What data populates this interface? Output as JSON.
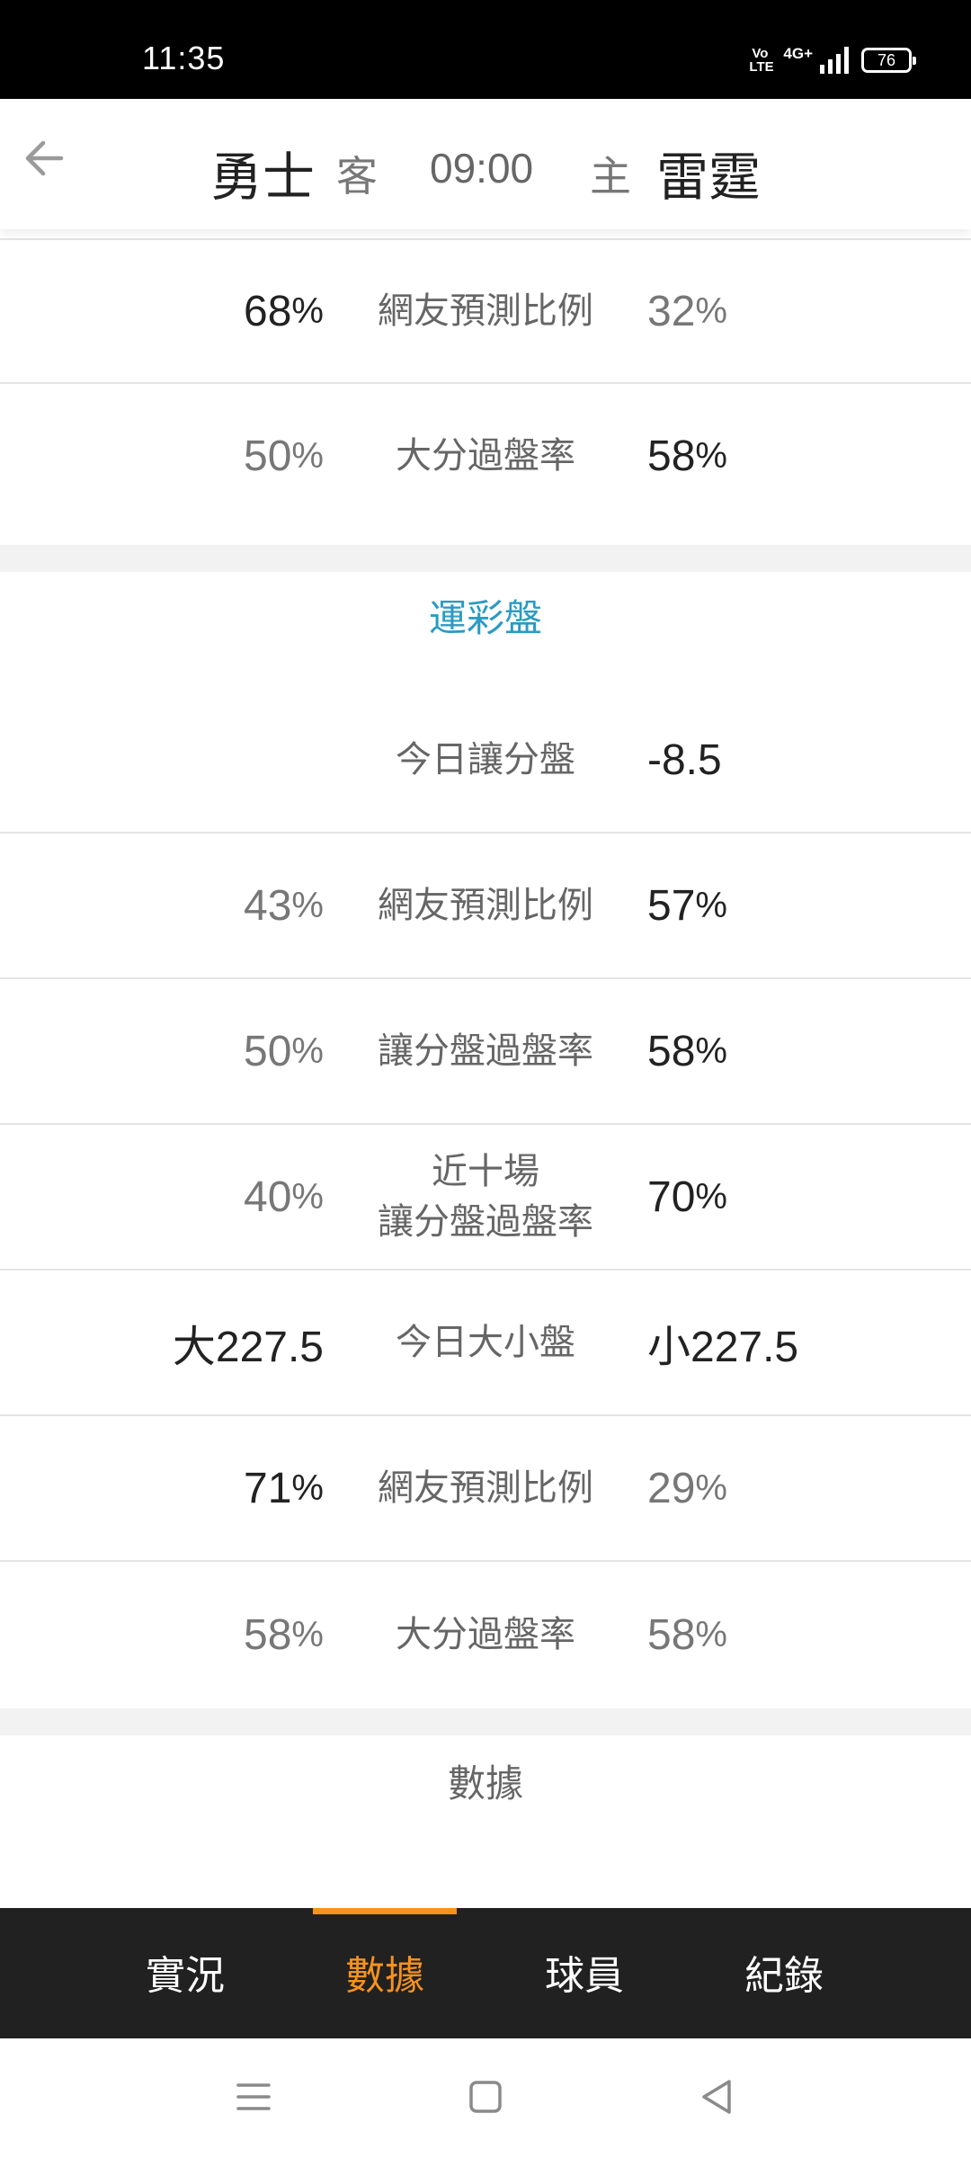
{
  "status_bar": {
    "time": "11:35",
    "volte": "Vo LTE",
    "network": "4G+",
    "battery": "76"
  },
  "header": {
    "away_team": "勇士",
    "away_tag": "客",
    "game_time": "09:00",
    "home_tag": "主",
    "home_team": "雷霆"
  },
  "stats_top": [
    {
      "left_value": "68",
      "left_unit": "%",
      "label": "網友預測比例",
      "right_value": "32",
      "right_unit": "%"
    },
    {
      "left_value": "50",
      "left_unit": "%",
      "label": "大分過盤率",
      "right_value": "58",
      "right_unit": "%"
    }
  ],
  "section_title": "運彩盤",
  "stats_lottery": [
    {
      "left_value": "",
      "left_unit": "",
      "label": "今日讓分盤",
      "right_value": "-8.5",
      "right_unit": ""
    },
    {
      "left_value": "43",
      "left_unit": "%",
      "label": "網友預測比例",
      "right_value": "57",
      "right_unit": "%"
    },
    {
      "left_value": "50",
      "left_unit": "%",
      "label": "讓分盤過盤率",
      "right_value": "58",
      "right_unit": "%"
    },
    {
      "left_value": "40",
      "left_unit": "%",
      "label_line1": "近十場",
      "label_line2": "讓分盤過盤率",
      "right_value": "70",
      "right_unit": "%"
    },
    {
      "left_value": "大227.5",
      "left_unit": "",
      "label": "今日大小盤",
      "right_value": "小227.5",
      "right_unit": ""
    },
    {
      "left_value": "71",
      "left_unit": "%",
      "label": "網友預測比例",
      "right_value": "29",
      "right_unit": "%"
    },
    {
      "left_value": "58",
      "left_unit": "%",
      "label": "大分過盤率",
      "right_value": "58",
      "right_unit": "%"
    }
  ],
  "footer_label": "數據",
  "tabs": [
    {
      "label": "實況",
      "active": false
    },
    {
      "label": "數據",
      "active": true
    },
    {
      "label": "球員",
      "active": false
    },
    {
      "label": "紀錄",
      "active": false
    }
  ],
  "colors": {
    "accent": "#f7921e",
    "section": "#2a9bc2",
    "tab_bar": "#212121"
  },
  "icons": {
    "back": "arrow-left-icon",
    "menu": "menu-icon",
    "home": "square-home-icon",
    "back_nav": "triangle-back-icon"
  }
}
